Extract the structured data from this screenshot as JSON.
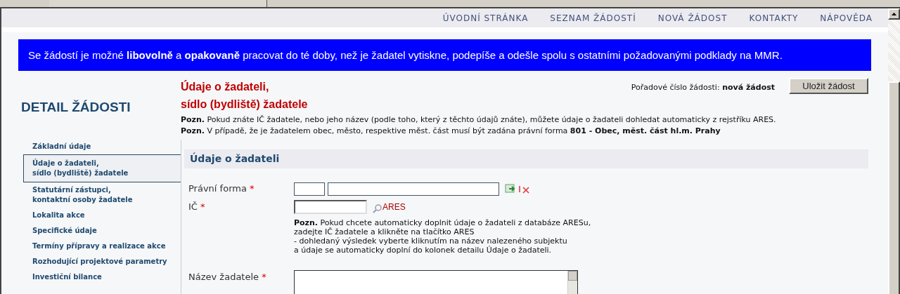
{
  "nav": [
    {
      "label": "ÚVODNÍ STRÁNKA"
    },
    {
      "label": "SEZNAM ŽÁDOSTÍ"
    },
    {
      "label": "NOVÁ ŽÁDOST"
    },
    {
      "label": "KONTAKTY"
    },
    {
      "label": "NÁPOVĚDA"
    }
  ],
  "banner": "Se žádostí je možné **libovolně** a **opakovaně** pracovat do té doby, než je žadatel vytiskne, podepíše a odešle spolu s ostatními požadovanými podklady na MMR.",
  "sidebar": {
    "title": "DETAIL ŽÁDOSTI",
    "items": [
      {
        "lines": [
          "Základní údaje"
        ],
        "selected": false
      },
      {
        "lines": [
          "Údaje o žadateli,",
          "sídlo (bydliště) žadatele"
        ],
        "selected": true
      },
      {
        "lines": [
          "Statutární zástupci,",
          "kontaktní osoby žadatele"
        ],
        "selected": false
      },
      {
        "lines": [
          "Lokalita akce"
        ],
        "selected": false
      },
      {
        "lines": [
          "Specifické údaje"
        ],
        "selected": false
      },
      {
        "lines": [
          "Termíny přípravy a realizace akce"
        ],
        "selected": false
      },
      {
        "lines": [
          "Rozhodující projektové parametry"
        ],
        "selected": false
      },
      {
        "lines": [
          "Investiční bilance"
        ],
        "selected": false
      }
    ]
  },
  "heading": [
    "Údaje o žadateli,",
    "sídlo (bydliště) žadatele"
  ],
  "order_number": {
    "label": "Pořadové číslo žádosti:",
    "value": "nová žádost"
  },
  "save_button": "Uložit žádost",
  "notes": [
    "**Pozn.** Pokud znáte IČ žadatele, nebo jeho název (podle toho, který z těchto údajů znáte), můžete údaje o žadateli dohledat automaticky z rejstříku ARES.",
    "**Pozn.** V případě, že je žadatelem obec, město, respektive měst. část musí být zadána právní forma **801 - Obec, měst. část hl.m. Prahy**"
  ],
  "section": {
    "title": "Údaje o žadateli",
    "fields": [
      {
        "kind": "code_name",
        "label": "Právní forma",
        "required_mark": "*"
      },
      {
        "kind": "lookup",
        "label": "IČ",
        "required_mark": "*",
        "lookup_label": "ARES",
        "hint": [
          "**Pozn.** Pokud chcete automaticky doplnit údaje o žadateli z databáze ARESu,",
          "zadejte IČ žadatele a klikněte na tlačítko ARES",
          "- dohledaný výsledek vyberte kliknutím na název nalezeného subjektu",
          "a údaje se automaticky doplní do kolonek detailu Údaje o žadateli."
        ]
      },
      {
        "kind": "textarea",
        "label": "Název žadatele",
        "required_mark": "*"
      }
    ]
  }
}
